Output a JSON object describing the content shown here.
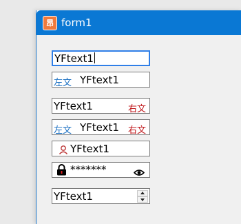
{
  "window": {
    "title": "form1",
    "app_icon_glyph": "昂"
  },
  "textboxes": {
    "tb1_value": "YFtext1",
    "tb2_left_label": "左文",
    "tb2_value": "YFtext1",
    "tb3_value": "YFtext1",
    "tb3_right_label": "右文",
    "tb4_left_label": "左文",
    "tb4_value": "YFtext1",
    "tb4_right_label": "右文",
    "tb5_value": "YFtext1",
    "tb6_password_mask": "*******",
    "numeric_value": "YFtext1"
  },
  "colors": {
    "titlebar": "#0a78d4",
    "left_label": "#1a6fc2",
    "right_label": "#c0181c",
    "focus_border": "#2f7fe8"
  },
  "icons": {
    "user": "user-icon",
    "lock": "lock-icon",
    "eye": "eye-icon"
  }
}
